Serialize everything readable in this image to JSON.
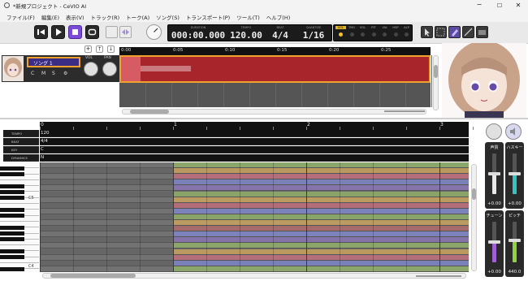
{
  "window": {
    "title": "*新規プロジェクト - CeVIO AI"
  },
  "menu": [
    "ファイル(F)",
    "編集(E)",
    "表示(V)",
    "トラック(R)",
    "トーク(A)",
    "ソング(S)",
    "トランスポート(P)",
    "ツール(T)",
    "ヘルプ(H)"
  ],
  "transport": {
    "duration_label": "DURATION",
    "duration": "000:00.000",
    "tempo_label": "TEMPO",
    "tempo": "120.00",
    "beat_label": "BEAT",
    "beat": "4/4",
    "quantize_label": "QUANTIZE",
    "quantize": "1/16"
  },
  "param_tabs": [
    "VOL",
    "TMG",
    "VOL",
    "PIT",
    "VIA",
    "HSP",
    "ALP"
  ],
  "track": {
    "name": "ソング 1",
    "buttons": [
      "C",
      "M",
      "S"
    ],
    "vol_label": "VOL",
    "pan_label": "PAN"
  },
  "timeline": {
    "marks": [
      "0:00",
      "0:05",
      "0:10",
      "0:15",
      "0:20",
      "0:25"
    ]
  },
  "editor": {
    "measures": [
      "0",
      "1",
      "2",
      "3"
    ],
    "rows": [
      {
        "label": "TEMPO",
        "value": "120"
      },
      {
        "label": "BEAT",
        "value": "4/4"
      },
      {
        "label": "KEY",
        "value": "C"
      },
      {
        "label": "DYNAMICS",
        "value": "N"
      }
    ],
    "octaves": [
      "C5",
      "C4"
    ]
  },
  "faders": [
    {
      "label": "声質",
      "value": "+0.00",
      "color": "#e8e8e8",
      "level": 0.5
    },
    {
      "label": "ハスキー",
      "value": "+0.00",
      "color": "#35c4c4",
      "level": 0.5
    },
    {
      "label": "チューン",
      "value": "+0.00",
      "color": "#a15fd6",
      "level": 0.5
    },
    {
      "label": "ピッチ",
      "value": "440.0",
      "color": "#8fd33d",
      "level": 0.55
    }
  ],
  "colors": {
    "accent": "#f2a12e",
    "track_region": "#a8262b"
  }
}
